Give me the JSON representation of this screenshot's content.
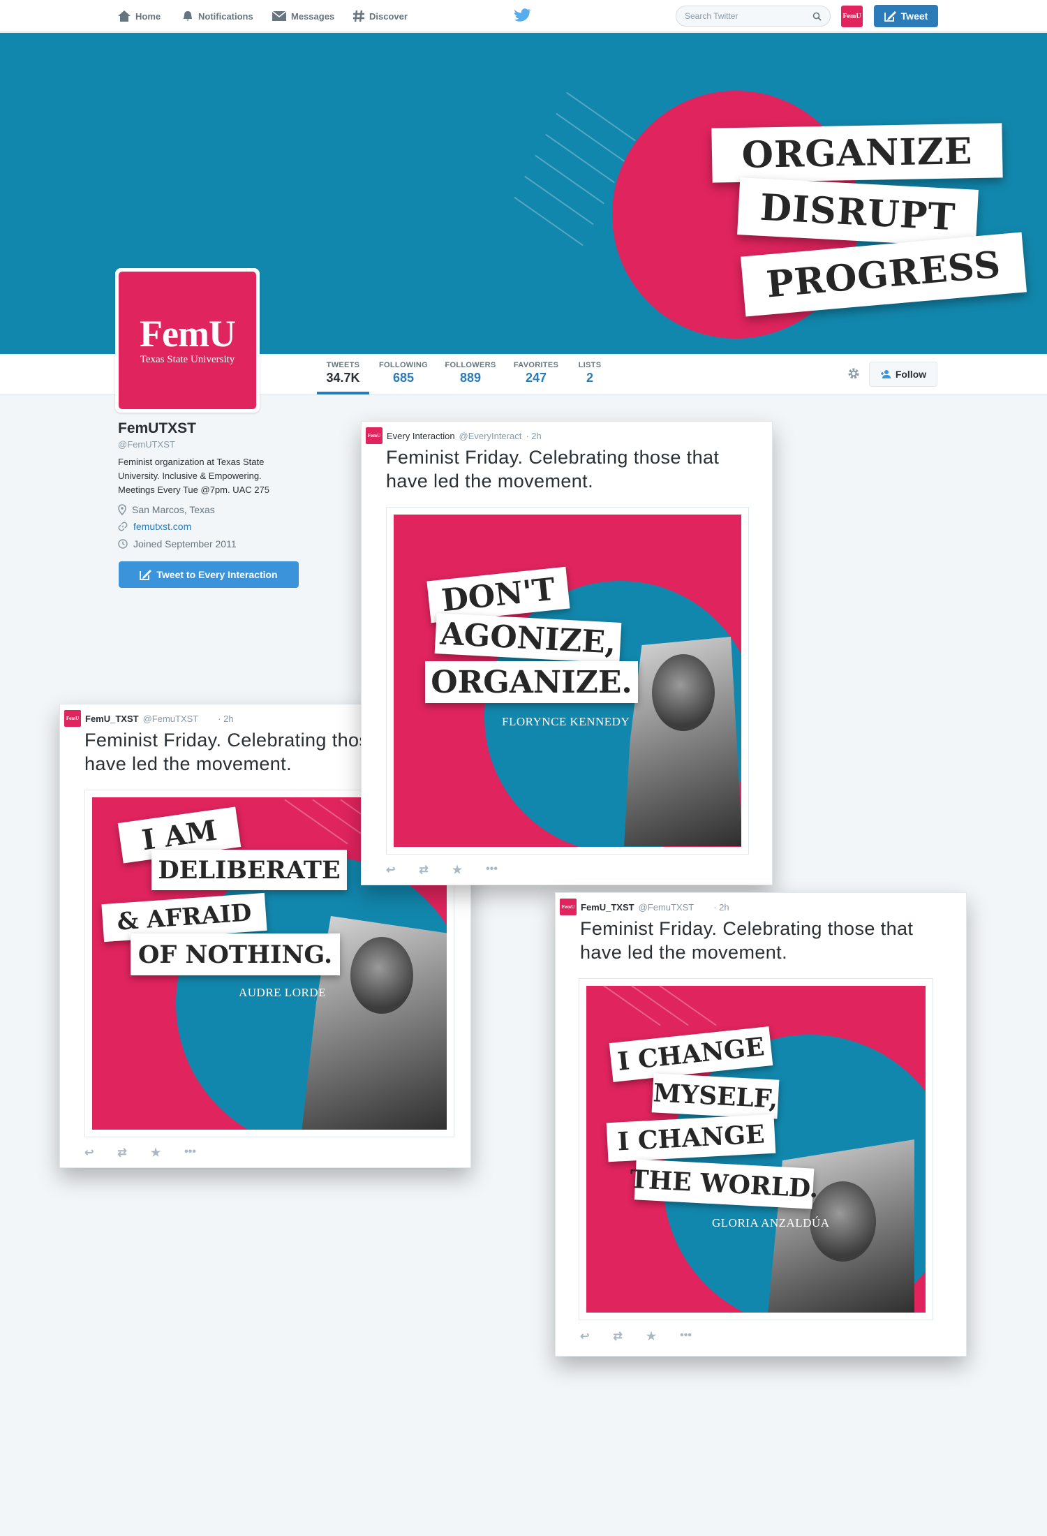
{
  "nav": {
    "home": "Home",
    "notifications": "Notifications",
    "messages": "Messages",
    "discover": "Discover",
    "search_placeholder": "Search Twitter",
    "tweet_button": "Tweet",
    "avatar_text": "FemU"
  },
  "banner": {
    "lines": [
      "ORGANIZE",
      "DISRUPT",
      "PROGRESS"
    ]
  },
  "stats": [
    {
      "label": "TWEETS",
      "value": "34.7K"
    },
    {
      "label": "FOLLOWING",
      "value": "685"
    },
    {
      "label": "FOLLOWERS",
      "value": "889"
    },
    {
      "label": "FAVORITES",
      "value": "247"
    },
    {
      "label": "LISTS",
      "value": "2"
    }
  ],
  "follow_button": "Follow",
  "profile": {
    "logo": "FemU",
    "logo_sub": "Texas State University",
    "name": "FemUTXST",
    "handle": "@FemUTXST",
    "bio": "Feminist organization at Texas State University. Inclusive & Empowering. Meetings Every Tue @7pm. UAC 275",
    "location": "San Marcos, Texas",
    "website": "femutxst.com",
    "joined": "Joined September 2011",
    "tweet_to": "Tweet to Every Interaction"
  },
  "tweets": [
    {
      "name": "Every Interaction",
      "handle": "@EveryInteract",
      "time": "· 2h",
      "text": "Feminist Friday. Celebrating those that have led the movement.",
      "quote": [
        "DON'T",
        "AGONIZE,",
        "ORGANIZE."
      ],
      "attribution": "FLORYNCE KENNEDY"
    },
    {
      "name": "FemU_TXST",
      "handle": "@FemuTXST",
      "time": "· 2h",
      "text": "Feminist Friday. Celebrating those that have led the movement.",
      "quote": [
        "I AM",
        "DELIBERATE",
        "& AFRAID",
        "OF NOTHING."
      ],
      "attribution": "AUDRE LORDE"
    },
    {
      "name": "FemU_TXST",
      "handle": "@FemuTXST",
      "time": "· 2h",
      "text": "Feminist Friday. Celebrating those that have led the movement.",
      "quote": [
        "I CHANGE",
        "MYSELF,",
        "I CHANGE",
        "THE WORLD."
      ],
      "attribution": "GLORIA ANZALDÚA"
    }
  ],
  "colors": {
    "brand_pink": "#e0245e",
    "brand_teal": "#1287ad",
    "twitter_blue": "#2b7bb9"
  }
}
